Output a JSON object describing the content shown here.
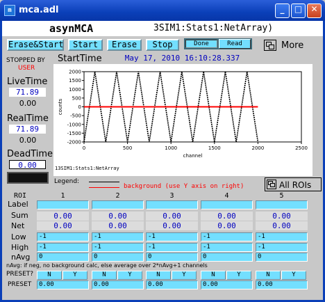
{
  "window": {
    "title": "mca.adl",
    "icon": "medm-icon",
    "min": "_",
    "max": "□",
    "close": "✕"
  },
  "header": {
    "name": "asynMCA",
    "pv": "3SIM1:Stats1:NetArray)"
  },
  "toolbar": {
    "erase_start": "Erase&Start",
    "start": "Start",
    "erase": "Erase",
    "stop": "Stop",
    "done": "Done",
    "read": "Read",
    "more": "More"
  },
  "status": {
    "stopped_by_label": "STOPPED BY",
    "stopped_by_value": "USER",
    "start_time_label": "StartTime",
    "start_time_value": "May 17, 2010 16:10:28.337"
  },
  "live": {
    "label": "LiveTime",
    "value": "71.89",
    "preset": "0.00"
  },
  "real": {
    "label": "RealTime",
    "value": "71.89",
    "preset": "0.00"
  },
  "dead": {
    "label": "DeadTime",
    "value": "0.00"
  },
  "chart_data": {
    "type": "line",
    "title": "",
    "xlabel": "channel",
    "ylabel": "counts",
    "xlim": [
      0,
      2500
    ],
    "ylim": [
      -2000,
      2000
    ],
    "x_ticks": [
      "0",
      "500",
      "1000",
      "1500",
      "2000",
      "2500"
    ],
    "y_ticks": [
      "2000",
      "1500",
      "1000",
      "500",
      "0",
      "-500",
      "-1000",
      "-1500",
      "-2000"
    ],
    "pv_label": "13SIM1:Stats1:NetArray",
    "series": [
      {
        "values_desc": "sawtooth",
        "period": 250,
        "min": -2000,
        "max": 2000,
        "x_end": 2000,
        "color": "#000000"
      },
      {
        "name": "background (use Y axis on right)",
        "x": [
          0,
          2000
        ],
        "y": [
          0,
          0
        ],
        "color": "#ff0000"
      }
    ]
  },
  "legend": {
    "label": "Legend:",
    "background_text": "background (use Y axis on right)"
  },
  "all_rois": "All ROIs",
  "roi_table": {
    "roi_header": "ROI",
    "columns": [
      "1",
      "2",
      "3",
      "4",
      "5"
    ],
    "row_labels": {
      "label": "Label",
      "sum": "Sum",
      "net": "Net",
      "low": "Low",
      "high": "High",
      "navg": "nAvg",
      "preset_q": "PRESET?",
      "preset": "PRESET"
    },
    "sum": [
      "0.00",
      "0.00",
      "0.00",
      "0.00",
      "0.00"
    ],
    "net": [
      "0.00",
      "0.00",
      "0.00",
      "0.00",
      "0.00"
    ],
    "low": [
      "-1",
      "-1",
      "-1",
      "-1",
      "-1"
    ],
    "high": [
      "-1",
      "-1",
      "-1",
      "-1",
      "-1"
    ],
    "navg": [
      "0",
      "0",
      "0",
      "0",
      "0"
    ],
    "preset": [
      "0.00",
      "0.00",
      "0.00",
      "0.00",
      "0.00"
    ],
    "n": "N",
    "y": "Y",
    "note": "nAvg: if neg, no background calc, else average over 2*nAvg+1 channels"
  }
}
